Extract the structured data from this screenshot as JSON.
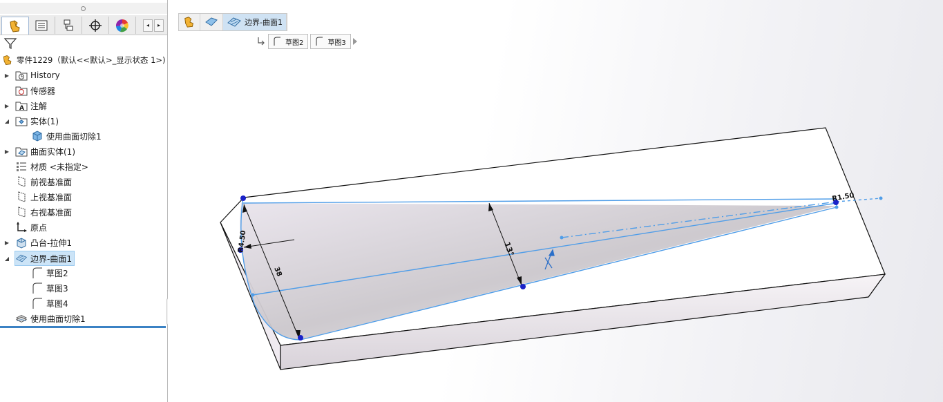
{
  "tabs": [
    {
      "name": "featuremanager-tab",
      "icon": "part-icon"
    },
    {
      "name": "propertymanager-tab",
      "icon": "property-list-icon"
    },
    {
      "name": "configurationmanager-tab",
      "icon": "configuration-icon"
    },
    {
      "name": "dimxpert-tab",
      "icon": "crosshair-icon"
    },
    {
      "name": "appearance-tab",
      "icon": "color-wheel-icon"
    }
  ],
  "tree": {
    "root_label": "零件1229（默认<<默认>_显示状态 1>)",
    "items": [
      {
        "label": "History",
        "icon": "history-folder-icon",
        "expand": "collapsed"
      },
      {
        "label": "传感器",
        "icon": "sensor-folder-icon",
        "expand": "none"
      },
      {
        "label": "注解",
        "icon": "annotation-icon",
        "expand": "collapsed"
      },
      {
        "label": "实体(1)",
        "icon": "solid-bodies-folder-icon",
        "expand": "expanded"
      },
      {
        "label": "使用曲面切除1",
        "icon": "solid-body-icon",
        "expand": "none"
      },
      {
        "label": "曲面实体(1)",
        "icon": "surface-bodies-folder-icon",
        "expand": "collapsed"
      },
      {
        "label": "材质 <未指定>",
        "icon": "material-icon",
        "expand": "none"
      },
      {
        "label": "前视基准面",
        "icon": "plane-icon",
        "expand": "none"
      },
      {
        "label": "上视基准面",
        "icon": "plane-icon",
        "expand": "none"
      },
      {
        "label": "右视基准面",
        "icon": "plane-icon",
        "expand": "none"
      },
      {
        "label": "原点",
        "icon": "origin-icon",
        "expand": "none"
      },
      {
        "label": "凸台-拉伸1",
        "icon": "extrude-icon",
        "expand": "collapsed"
      },
      {
        "label": "边界-曲面1",
        "icon": "boundary-surface-icon",
        "expand": "expanded",
        "selected": true
      },
      {
        "label": "草图2",
        "icon": "sketch-icon",
        "expand": "none"
      },
      {
        "label": "草图3",
        "icon": "sketch-icon",
        "expand": "none"
      },
      {
        "label": "草图4",
        "icon": "sketch-icon",
        "expand": "none"
      },
      {
        "label": "使用曲面切除1",
        "icon": "surface-cut-icon",
        "expand": "none"
      }
    ]
  },
  "breadcrumb": {
    "items": [
      "part-icon",
      "solid-body-icon",
      "boundary-surface-icon"
    ],
    "active_label": "边界-曲面1"
  },
  "sketch_crumbs": [
    "草图2",
    "草图3"
  ],
  "dimensions": {
    "radius": "R4.50",
    "length": "38",
    "angle": "13°",
    "end_radius": "R1.50"
  },
  "colors": {
    "accent": "#3b82c4",
    "selection": "#cce4f7",
    "sketch_line": "#4f9de8",
    "sketch_point": "#1a22c8"
  }
}
